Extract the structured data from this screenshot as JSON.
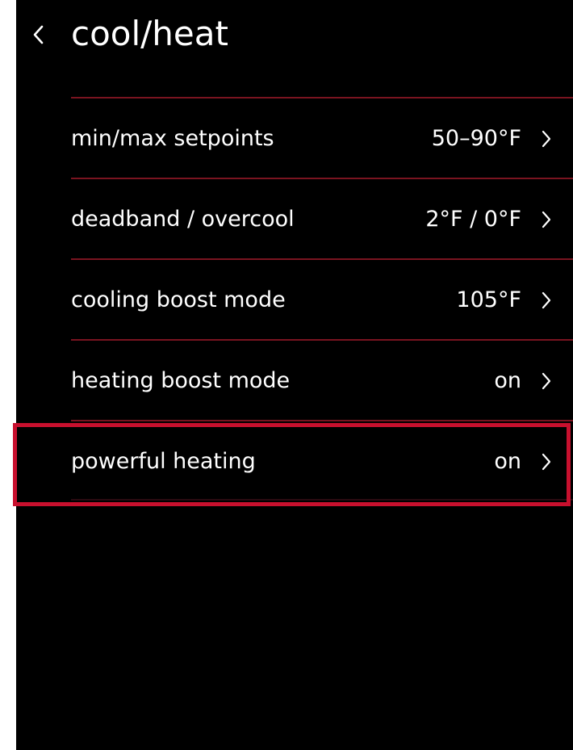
{
  "header": {
    "back_icon": "chevron-left-icon",
    "title": "cool/heat"
  },
  "settings": [
    {
      "label": "min/max setpoints",
      "value": "50–90°F"
    },
    {
      "label": "deadband / overcool",
      "value": "2°F / 0°F"
    },
    {
      "label": "cooling boost mode",
      "value": "105°F"
    },
    {
      "label": "heating boost mode",
      "value": "on"
    },
    {
      "label": "powerful heating",
      "value": "on"
    }
  ],
  "highlighted_item": "powerful heating",
  "colors": {
    "background": "#000000",
    "text": "#ffffff",
    "divider": "#7a1420",
    "highlight": "#c8102e"
  }
}
